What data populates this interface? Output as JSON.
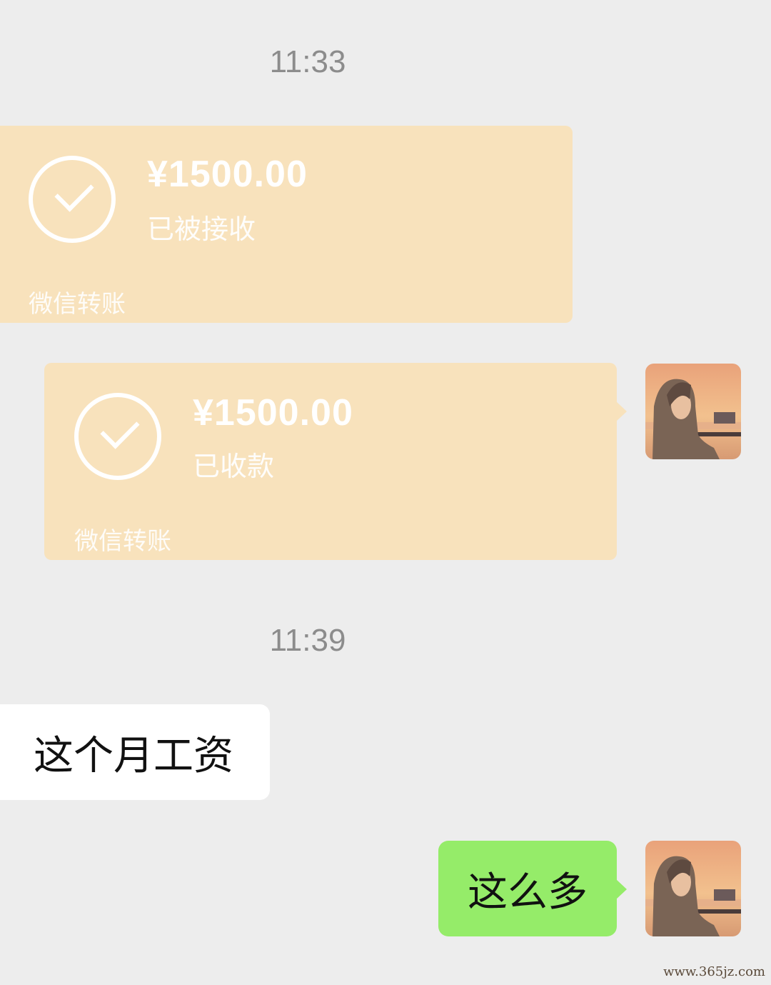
{
  "timestamps": [
    "11:33",
    "11:39"
  ],
  "transfer_received": {
    "amount": "¥1500.00",
    "status": "已被接收",
    "label": "微信转账"
  },
  "transfer_sent": {
    "amount": "¥1500.00",
    "status": "已收款",
    "label": "微信转账"
  },
  "message_incoming": "这个月工资",
  "message_outgoing": "这么多",
  "watermark": "www.365jz.com",
  "colors": {
    "transfer_bubble": "#f8e2bc",
    "outgoing_bubble": "#95ec69",
    "incoming_bubble": "#ffffff",
    "background": "#ededed"
  }
}
